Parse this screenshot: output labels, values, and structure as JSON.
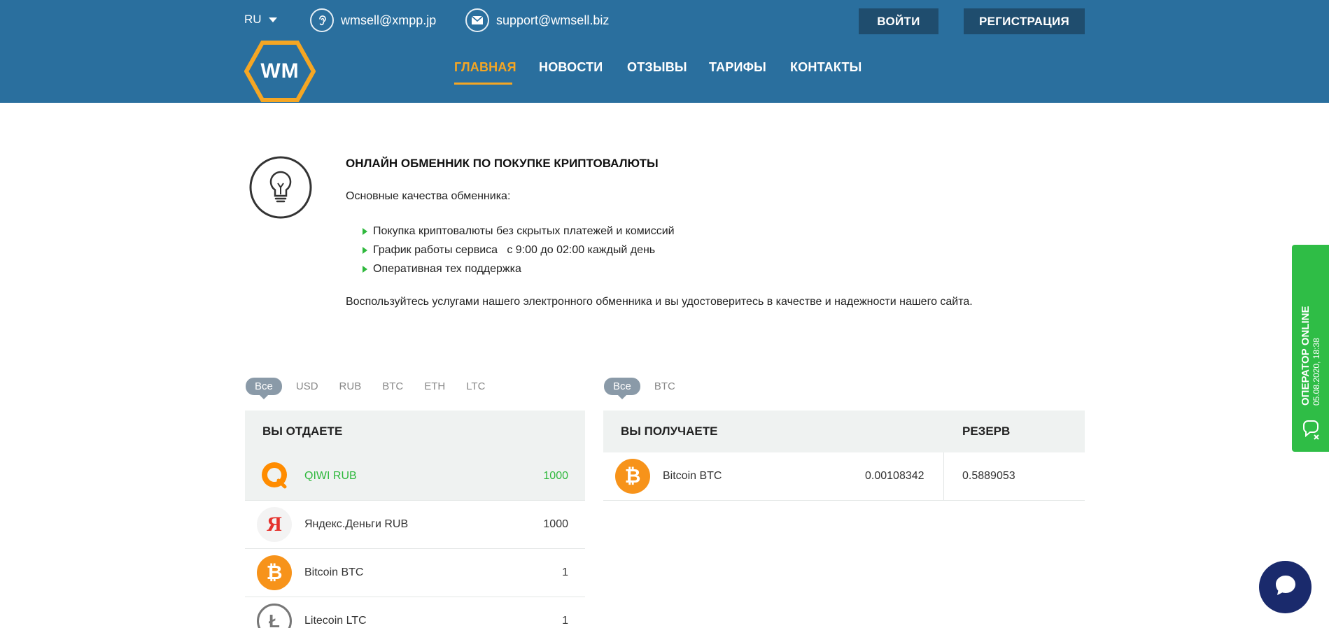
{
  "header": {
    "lang": "RU",
    "contact_xmpp": "wmsell@xmpp.jp",
    "contact_email": "support@wmsell.biz",
    "login": "ВОЙТИ",
    "register": "РЕГИСТРАЦИЯ",
    "logo_text": "WM",
    "nav": [
      "ГЛАВНАЯ",
      "НОВОСТИ",
      "ОТЗЫВЫ",
      "ТАРИФЫ",
      "КОНТАКТЫ"
    ]
  },
  "intro": {
    "title": "ОНЛАЙН ОБМЕННИК ПО ПОКУПКЕ КРИПТОВАЛЮТЫ",
    "subtitle": "Основные качества обменника:",
    "bullets": [
      "Покупка криптовалюты без скрытых платежей и комиссий",
      "График работы сервиса   с 9:00 до 02:00 каждый день",
      "Оперативная тех поддержка"
    ],
    "footer": "Воспользуйтесь услугами нашего электронного обменника и вы удостоверитесь в качестве и надежности нашего сайта."
  },
  "filters_give": [
    "Все",
    "USD",
    "RUB",
    "BTC",
    "ETH",
    "LTC"
  ],
  "filters_get": [
    "Все",
    "BTC"
  ],
  "give_table": {
    "header": "ВЫ ОТДАЕТЕ",
    "rows": [
      {
        "name": "QIWI RUB",
        "value": "1000"
      },
      {
        "name": "Яндекс.Деньги RUB",
        "value": "1000"
      },
      {
        "name": "Bitcoin BTC",
        "value": "1"
      },
      {
        "name": "Litecoin LTC",
        "value": "1"
      }
    ]
  },
  "get_table": {
    "header": "ВЫ ПОЛУЧАЕТЕ",
    "reserve_header": "РЕЗЕРВ",
    "rows": [
      {
        "name": "Bitcoin BTC",
        "amount": "0.00108342",
        "reserve": "0.5889053"
      }
    ]
  },
  "operator": {
    "title": "ОПЕРАТОР ONLINE",
    "datetime": "05.08.2020, 18:38"
  },
  "colors": {
    "header_bg": "#2a6f9e",
    "accent": "#f5a623",
    "green": "#2eb83c",
    "dark_button": "#1f4d6e",
    "chat_bubble": "#1a2a6c"
  },
  "icons": {
    "xmpp": "ear-icon",
    "email": "envelope-icon",
    "bulb": "lightbulb-icon",
    "qiwi": "qiwi-logo-icon",
    "yandex": "yandex-logo-icon",
    "bitcoin": "bitcoin-icon",
    "litecoin": "litecoin-icon",
    "chat": "chat-icon"
  }
}
